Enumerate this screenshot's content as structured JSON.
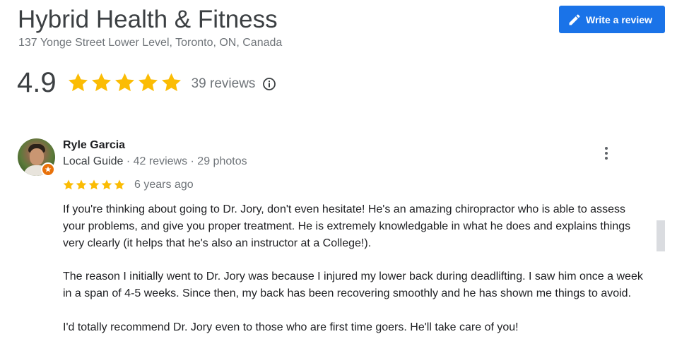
{
  "business": {
    "name": "Hybrid Health & Fitness",
    "address": "137 Yonge Street Lower Level, Toronto, ON, Canada"
  },
  "write_review_button": {
    "label": "Write a review",
    "icon": "pencil-icon"
  },
  "summary": {
    "rating": "4.9",
    "stars": 5,
    "review_count": "39 reviews",
    "info_icon": "info-icon"
  },
  "review": {
    "reviewer_name": "Ryle Garcia",
    "guide_label": "Local Guide",
    "reviewer_stats": " · 42 reviews · 29 photos",
    "stars": 5,
    "date": "6 years ago",
    "paragraphs": [
      "If you're thinking about going to Dr. Jory, don't even hesitate! He's an amazing chiropractor who is able to assess your problems, and give you  proper treatment. He is extremely knowledgable in what he does and explains things very clearly (it helps that he's also an instructor at a College!).",
      "The reason I initially went to Dr. Jory was because I injured my lower back during deadlifting. I saw him once a week in a span of 4-5 weeks. Since then, my back has been recovering smoothly and he has shown me things to avoid.",
      "I'd totally recommend Dr. Jory even to those who are first time goers. He'll take care of you!"
    ]
  },
  "colors": {
    "star": "#fbbc04",
    "button_bg": "#1a73e8",
    "badge": "#e8710a",
    "muted_text": "#70757a"
  }
}
